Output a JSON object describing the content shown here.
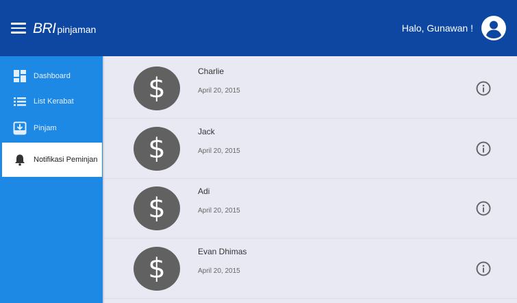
{
  "header": {
    "brand_name": "BRI",
    "brand_suffix": "pinjaman",
    "greeting": "Halo, Gunawan !",
    "icons": [
      "menu-icon",
      "account-circle-icon"
    ]
  },
  "sidebar": {
    "items": [
      {
        "label": "Dashboard",
        "icon": "dashboard-icon",
        "active": false
      },
      {
        "label": "List Kerabat",
        "icon": "list-icon",
        "active": false
      },
      {
        "label": "Pinjam",
        "icon": "download-icon",
        "active": false
      },
      {
        "label": "Notifikasi Peminjan",
        "icon": "bell-icon",
        "active": true
      }
    ]
  },
  "notifications": [
    {
      "name": "Charlie",
      "date": "April 20, 2015",
      "icon": "dollar-icon",
      "action_icon": "info-icon"
    },
    {
      "name": "Jack",
      "date": "April 20, 2015",
      "icon": "dollar-icon",
      "action_icon": "info-icon"
    },
    {
      "name": "Adi",
      "date": "April 20, 2015",
      "icon": "dollar-icon",
      "action_icon": "info-icon"
    },
    {
      "name": "Evan Dhimas",
      "date": "April 20, 2015",
      "icon": "dollar-icon",
      "action_icon": "info-icon"
    }
  ],
  "coin_symbol": "$",
  "colors": {
    "header": "#0d47a1",
    "sidebar": "#1e88e5",
    "content_bg": "#e9e9f4",
    "coin": "#616161"
  }
}
